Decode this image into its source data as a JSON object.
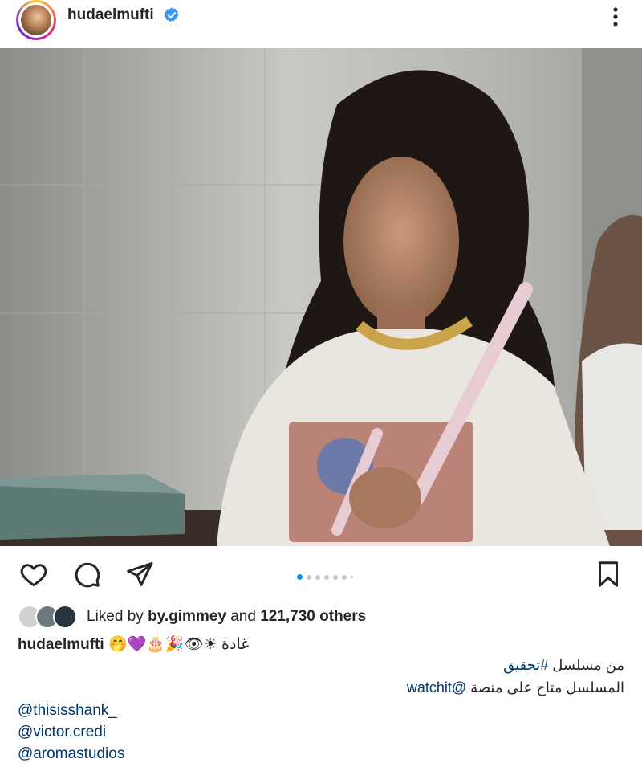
{
  "post": {
    "username": "hudaelmufti",
    "verified": true,
    "caption_emojis": "🤭💜🎂🎉👁☀",
    "caption_arabic_name": "غادة",
    "caption_line2_prefix": "من مسلسل ",
    "caption_line2_hashtag": "#تحقيق",
    "caption_line3_text": "المسلسل متاح على منصة ",
    "caption_line3_mention": "@watchit",
    "mentions": [
      "@thisisshank_",
      "@victor.credi",
      "@aromastudios"
    ]
  },
  "likes": {
    "prefix": "Liked by",
    "first_user": "by.gimmey",
    "connector": "and",
    "others": "121,730 others"
  },
  "carousel": {
    "count": 7,
    "active_index": 0
  },
  "icons": {
    "more": "more-vertical-icon",
    "like": "heart-icon",
    "comment": "comment-icon",
    "share": "send-icon",
    "save": "bookmark-icon",
    "verified": "verified-badge-icon"
  },
  "colors": {
    "verified": "#3897f0",
    "link": "#00376b",
    "active_dot": "#0095f6"
  }
}
